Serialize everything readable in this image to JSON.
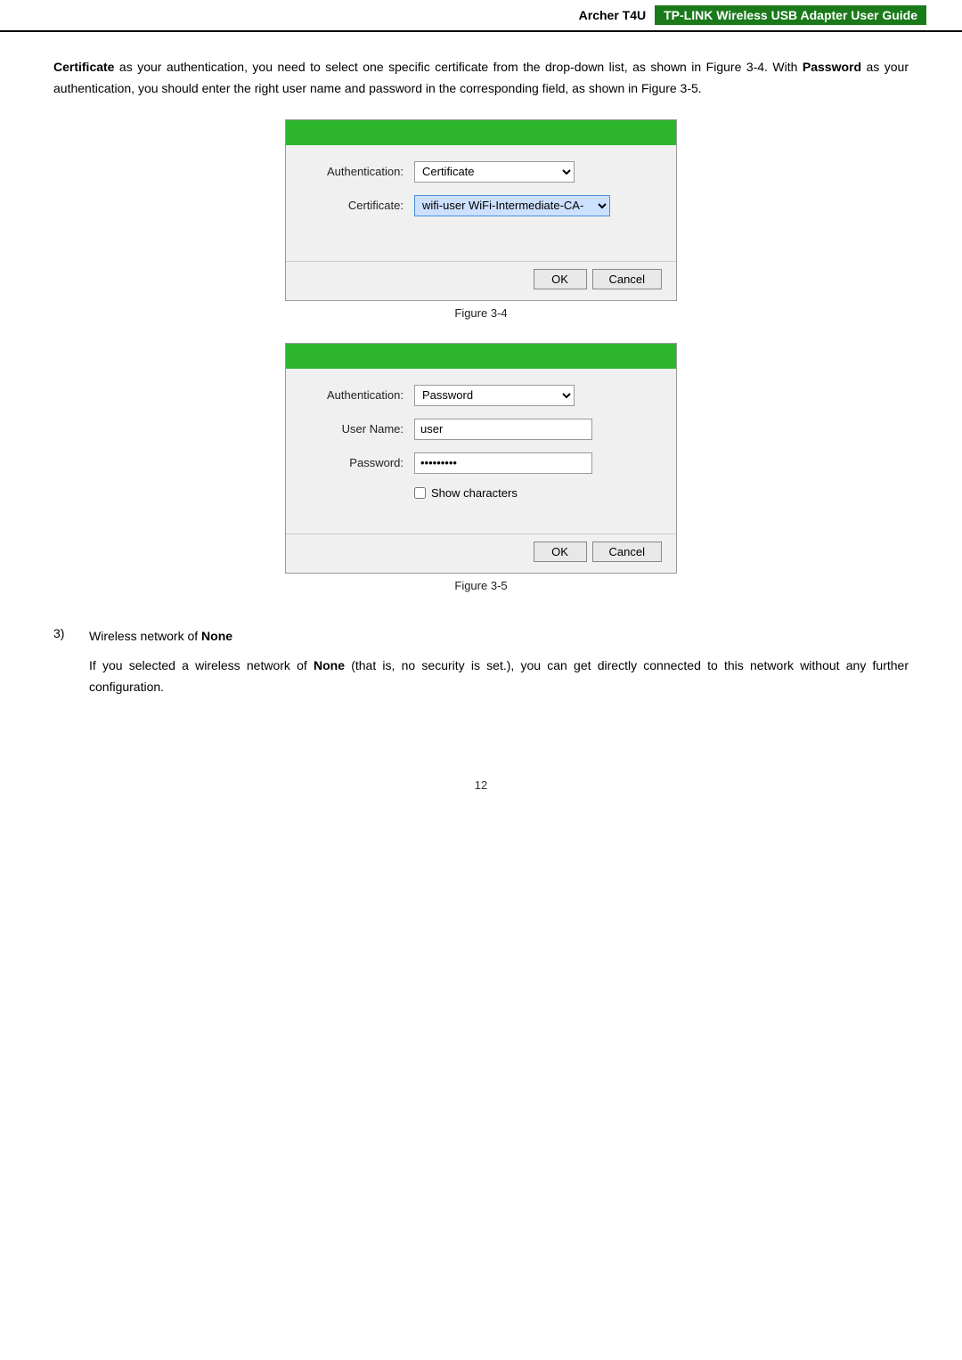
{
  "header": {
    "model": "Archer T4U",
    "guide_title": "TP-LINK Wireless USB Adapter User Guide"
  },
  "intro": {
    "text_parts": [
      {
        "bold": true,
        "text": "Certificate"
      },
      {
        "bold": false,
        "text": " as your authentication, you need to select one specific certificate from the drop-down list, as shown in Figure 3-4. With "
      },
      {
        "bold": true,
        "text": "Password"
      },
      {
        "bold": false,
        "text": " as your authentication, you should enter the right user name and password in the corresponding field, as shown in Figure 3-5."
      }
    ]
  },
  "figure4": {
    "label": "Figure 3-4",
    "auth_label": "Authentication:",
    "auth_value": "Certificate",
    "cert_label": "Certificate:",
    "cert_value": "wifi-user  WiFi-Intermediate-CA-",
    "ok_label": "OK",
    "cancel_label": "Cancel"
  },
  "figure5": {
    "label": "Figure 3-5",
    "auth_label": "Authentication:",
    "auth_value": "Password",
    "username_label": "User Name:",
    "username_value": "user",
    "password_label": "Password:",
    "password_value": "••••••••",
    "show_chars_label": "Show characters",
    "ok_label": "OK",
    "cancel_label": "Cancel"
  },
  "section3": {
    "number": "3)",
    "title_prefix": "Wireless network of ",
    "title_bold": "None",
    "body_prefix": "If you selected a wireless network of ",
    "body_bold": "None",
    "body_suffix": " (that is, no security is set.), you can get directly connected to this network without any further configuration."
  },
  "page_number": "12"
}
